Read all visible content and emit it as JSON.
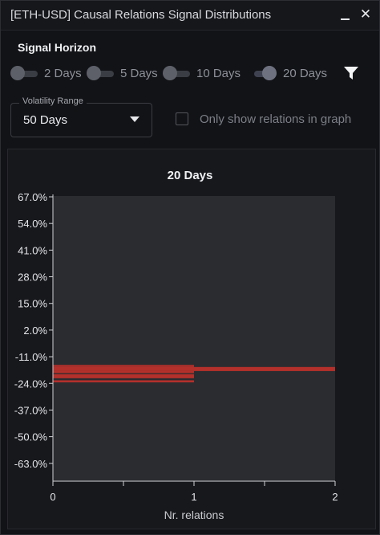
{
  "window": {
    "title": "[ETH-USD] Causal Relations Signal Distributions",
    "minimize_label": "_",
    "close_label": "✕"
  },
  "signal_horizon": {
    "label": "Signal Horizon",
    "options": [
      {
        "label": "2 Days",
        "on": false
      },
      {
        "label": "5 Days",
        "on": false
      },
      {
        "label": "10 Days",
        "on": false
      },
      {
        "label": "20 Days",
        "on": true
      }
    ]
  },
  "volatility": {
    "legend": "Volatility Range",
    "value": "50 Days"
  },
  "graph_filter": {
    "label": "Only show relations in graph",
    "checked": false
  },
  "icons": {
    "filter": "filter-icon",
    "dropdown": "chevron-down-icon"
  },
  "colors": {
    "bar": "#b3302b",
    "plot_bg": "#2b2c30",
    "panel_bg": "#17181c"
  },
  "chart_data": {
    "type": "bar",
    "orientation": "horizontal",
    "title": "20 Days",
    "xlabel": "Nr. relations",
    "ylabel": "",
    "xlim": [
      0,
      2
    ],
    "ylim": [
      -67,
      67
    ],
    "x_ticks": [
      "0",
      "1",
      "2"
    ],
    "y_ticks": [
      "67.0%",
      "54.0%",
      "41.0%",
      "28.0%",
      "15.0%",
      "2.0%",
      "-11.0%",
      "-24.0%",
      "-37.0%",
      "-50.0%",
      "-63.0%"
    ],
    "y_tick_values": [
      67,
      54,
      41,
      28,
      15,
      2,
      -11,
      -24,
      -37,
      -50,
      -63
    ],
    "bars": [
      {
        "y_from": -16.0,
        "y_to": -18.0,
        "value": 2
      },
      {
        "y_from": -15.0,
        "y_to": -16.0,
        "value": 1
      },
      {
        "y_from": -18.0,
        "y_to": -19.0,
        "value": 1
      },
      {
        "y_from": -19.5,
        "y_to": -21.5,
        "value": 1
      },
      {
        "y_from": -22.5,
        "y_to": -23.5,
        "value": 1
      }
    ],
    "grid": false
  }
}
